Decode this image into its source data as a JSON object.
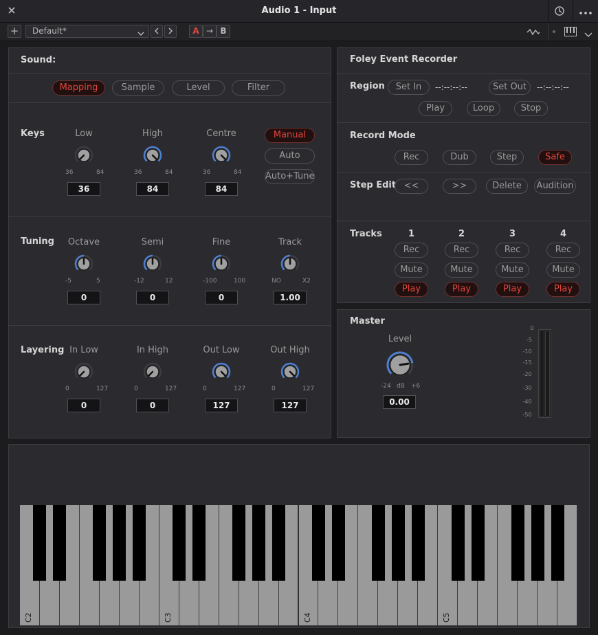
{
  "window": {
    "title": "Audio 1 -  Input"
  },
  "toolbar": {
    "preset": "Default*",
    "a_label": "A",
    "arrow": "→",
    "b_label": "B"
  },
  "sound": {
    "title": "Sound:",
    "tabs": [
      "Mapping",
      "Sample",
      "Level",
      "Filter"
    ],
    "active_tab": "Mapping"
  },
  "keys": {
    "title": "Keys",
    "knobs": [
      {
        "label": "Low",
        "min": "36",
        "max": "84",
        "value": "36"
      },
      {
        "label": "High",
        "min": "36",
        "max": "84",
        "value": "84"
      },
      {
        "label": "Centre",
        "min": "36",
        "max": "84",
        "value": "84"
      }
    ],
    "modes": [
      "Manual",
      "Auto",
      "Auto+Tune"
    ],
    "active_mode": "Manual"
  },
  "tuning": {
    "title": "Tuning",
    "knobs": [
      {
        "label": "Octave",
        "min": "-5",
        "max": "5",
        "value": "0"
      },
      {
        "label": "Semi",
        "min": "-12",
        "max": "12",
        "value": "0"
      },
      {
        "label": "Fine",
        "min": "-100",
        "max": "100",
        "value": "0"
      },
      {
        "label": "Track",
        "min": "NO",
        "max": "X2",
        "value": "1.00"
      }
    ]
  },
  "layering": {
    "title": "Layering",
    "knobs": [
      {
        "label": "In Low",
        "min": "0",
        "max": "127",
        "value": "0"
      },
      {
        "label": "In High",
        "min": "0",
        "max": "127",
        "value": "0"
      },
      {
        "label": "Out Low",
        "min": "0",
        "max": "127",
        "value": "127"
      },
      {
        "label": "Out High",
        "min": "0",
        "max": "127",
        "value": "127"
      }
    ]
  },
  "foley": {
    "title": "Foley Event Recorder",
    "region": {
      "label": "Region",
      "set_in": "Set In",
      "in_time": "--:--:--:--",
      "set_out": "Set Out",
      "out_time": "--:--:--:--",
      "play": "Play",
      "loop": "Loop",
      "stop": "Stop"
    },
    "record_mode": {
      "label": "Record Mode",
      "modes": [
        "Rec",
        "Dub",
        "Step",
        "Safe"
      ],
      "active": "Safe"
    },
    "step_edit": {
      "label": "Step Edit",
      "buttons": [
        "<<",
        ">>",
        "Delete",
        "Audition"
      ]
    },
    "tracks": {
      "label": "Tracks",
      "numbers": [
        "1",
        "2",
        "3",
        "4"
      ],
      "rec": "Rec",
      "mute": "Mute",
      "play": "Play"
    }
  },
  "master": {
    "title": "Master",
    "level_label": "Level",
    "min": "-24",
    "unit": "dB",
    "max": "+6",
    "value": "0.00",
    "meter_scale": [
      "0",
      "-5",
      "-10",
      "-15",
      "-20",
      "-30",
      "-40",
      "-50"
    ]
  },
  "keyboard": {
    "octave_labels": [
      "C2",
      "C3",
      "C4",
      "C5"
    ]
  }
}
